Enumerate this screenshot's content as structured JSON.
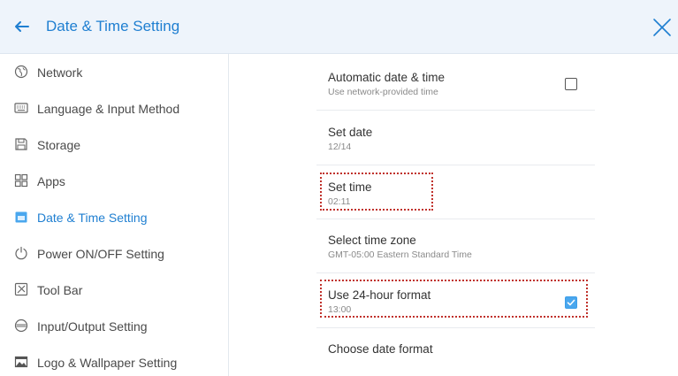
{
  "header": {
    "title": "Date & Time Setting"
  },
  "sidebar": {
    "items": [
      {
        "label": "Network",
        "icon": "globe-icon",
        "active": false
      },
      {
        "label": "Language & Input Method",
        "icon": "keyboard-icon",
        "active": false
      },
      {
        "label": "Storage",
        "icon": "storage-icon",
        "active": false
      },
      {
        "label": "Apps",
        "icon": "apps-grid-icon",
        "active": false
      },
      {
        "label": "Date & Time Setting",
        "icon": "calendar-icon",
        "active": true
      },
      {
        "label": "Power ON/OFF Setting",
        "icon": "power-icon",
        "active": false
      },
      {
        "label": "Tool Bar",
        "icon": "toolbar-icon",
        "active": false
      },
      {
        "label": "Input/Output Setting",
        "icon": "input-output-icon",
        "active": false
      },
      {
        "label": "Logo & Wallpaper Setting",
        "icon": "wallpaper-icon",
        "active": false
      }
    ]
  },
  "settings": {
    "auto_datetime": {
      "title": "Automatic date & time",
      "subtitle": "Use network-provided time",
      "checked": false
    },
    "set_date": {
      "title": "Set date",
      "value": "12/14"
    },
    "set_time": {
      "title": "Set time",
      "value": "02:11"
    },
    "time_zone": {
      "title": "Select time zone",
      "value": "GMT-05:00 Eastern Standard Time"
    },
    "hour24": {
      "title": "Use 24-hour format",
      "value": "13:00",
      "checked": true
    },
    "date_format": {
      "title": "Choose date format"
    }
  },
  "colors": {
    "accent": "#1f7fd1",
    "header_bg": "#eef4fb",
    "highlight": "#c0312b",
    "checkbox_checked": "#4aa7ee"
  }
}
